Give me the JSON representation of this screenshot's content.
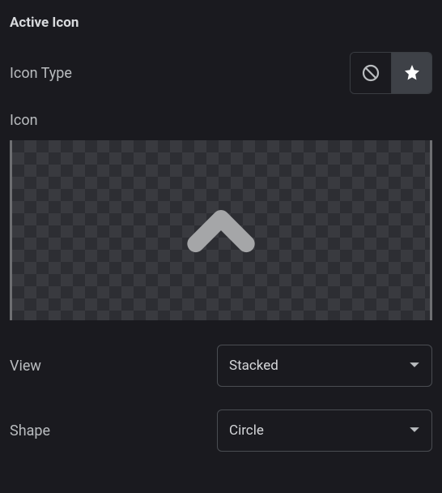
{
  "section": {
    "title": "Active Icon"
  },
  "iconType": {
    "label": "Icon Type",
    "options": [
      "None",
      "Icon"
    ],
    "selected": "Icon"
  },
  "icon": {
    "label": "Icon",
    "previewIcon": "chevron-up"
  },
  "view": {
    "label": "View",
    "value": "Stacked"
  },
  "shape": {
    "label": "Shape",
    "value": "Circle"
  }
}
